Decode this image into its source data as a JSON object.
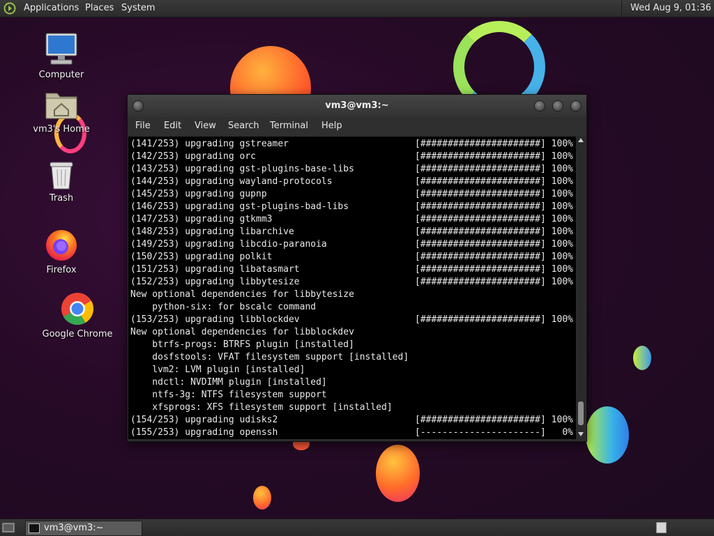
{
  "top_panel": {
    "menus": [
      "Applications",
      "Places",
      "System"
    ],
    "clock": {
      "date": "Wed Aug",
      "day_time": "9, 01:36"
    }
  },
  "desktop_icons": [
    {
      "label": "Computer",
      "icon": "computer-icon"
    },
    {
      "label": "vm3's Home",
      "icon": "home-folder-icon"
    },
    {
      "label": "Trash",
      "icon": "trash-icon"
    },
    {
      "label": "Firefox",
      "icon": "firefox-icon"
    },
    {
      "label": "Google Chrome",
      "icon": "chrome-icon"
    }
  ],
  "window": {
    "title": "vm3@vm3:~",
    "menu": [
      "File",
      "Edit",
      "View",
      "Search",
      "Terminal",
      "Help"
    ]
  },
  "terminal": {
    "lines": [
      {
        "text": "(141/253) upgrading gstreamer",
        "bar": "[######################] 100%"
      },
      {
        "text": "(142/253) upgrading orc",
        "bar": "[######################] 100%"
      },
      {
        "text": "(143/253) upgrading gst-plugins-base-libs",
        "bar": "[######################] 100%"
      },
      {
        "text": "(144/253) upgrading wayland-protocols",
        "bar": "[######################] 100%"
      },
      {
        "text": "(145/253) upgrading gupnp",
        "bar": "[######################] 100%"
      },
      {
        "text": "(146/253) upgrading gst-plugins-bad-libs",
        "bar": "[######################] 100%"
      },
      {
        "text": "(147/253) upgrading gtkmm3",
        "bar": "[######################] 100%"
      },
      {
        "text": "(148/253) upgrading libarchive",
        "bar": "[######################] 100%"
      },
      {
        "text": "(149/253) upgrading libcdio-paranoia",
        "bar": "[######################] 100%"
      },
      {
        "text": "(150/253) upgrading polkit",
        "bar": "[######################] 100%"
      },
      {
        "text": "(151/253) upgrading libatasmart",
        "bar": "[######################] 100%"
      },
      {
        "text": "(152/253) upgrading libbytesize",
        "bar": "[######################] 100%"
      },
      {
        "text": "New optional dependencies for libbytesize",
        "bar": ""
      },
      {
        "text": "    python-six: for bscalc command",
        "bar": ""
      },
      {
        "text": "(153/253) upgrading libblockdev",
        "bar": "[######################] 100%"
      },
      {
        "text": "New optional dependencies for libblockdev",
        "bar": ""
      },
      {
        "text": "    btrfs-progs: BTRFS plugin [installed]",
        "bar": ""
      },
      {
        "text": "    dosfstools: VFAT filesystem support [installed]",
        "bar": ""
      },
      {
        "text": "    lvm2: LVM plugin [installed]",
        "bar": ""
      },
      {
        "text": "    ndctl: NVDIMM plugin [installed]",
        "bar": ""
      },
      {
        "text": "    ntfs-3g: NTFS filesystem support",
        "bar": ""
      },
      {
        "text": "    xfsprogs: XFS filesystem support [installed]",
        "bar": ""
      },
      {
        "text": "(154/253) upgrading udisks2",
        "bar": "[######################] 100%"
      },
      {
        "text": "(155/253) upgrading openssh",
        "bar": "[----------------------]   0%"
      }
    ]
  },
  "taskbar": {
    "task_label": "vm3@vm3:~"
  },
  "colors": {
    "background": "#260a26",
    "terminal_bg": "#000000",
    "terminal_fg": "#e9e9e9",
    "panel": "#2f2f2f"
  }
}
